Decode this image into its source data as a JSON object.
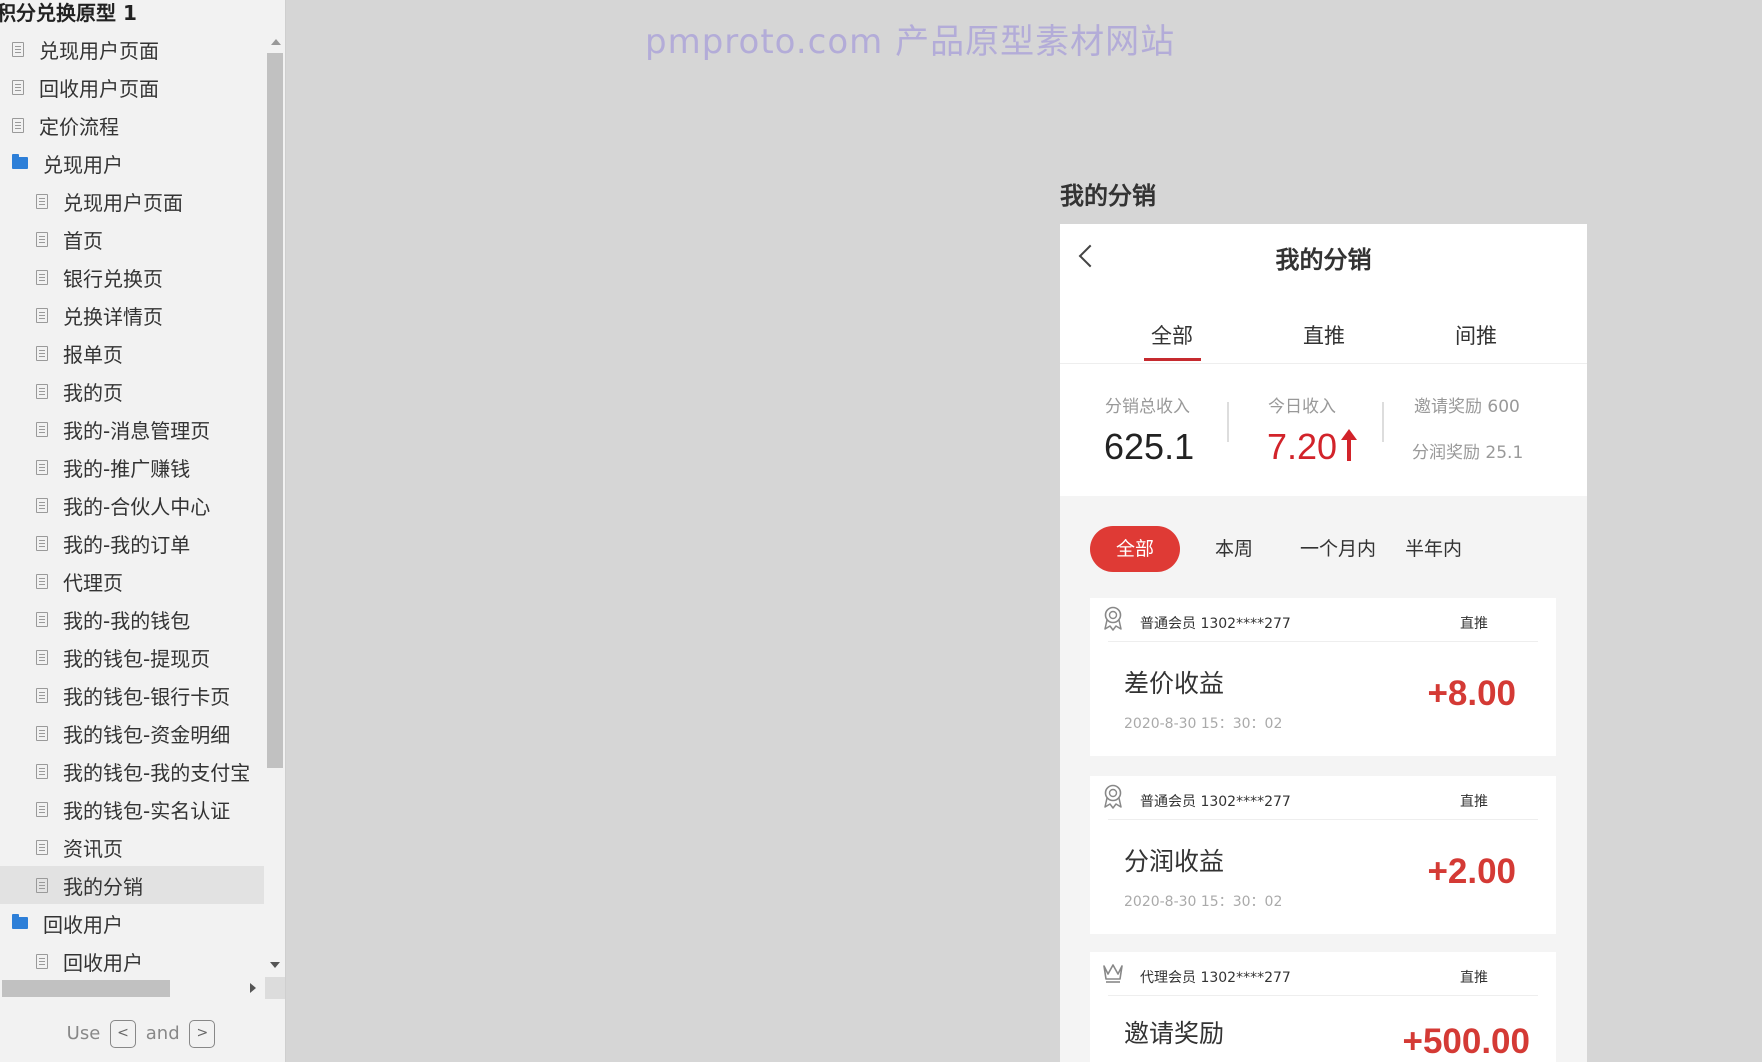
{
  "sidebar": {
    "title": "积分兑换原型 1",
    "items": [
      {
        "label": "兑现用户页面",
        "type": "page"
      },
      {
        "label": "回收用户页面",
        "type": "page"
      },
      {
        "label": "定价流程",
        "type": "page"
      },
      {
        "label": "兑现用户",
        "type": "folder"
      },
      {
        "label": "兑现用户页面",
        "type": "page"
      },
      {
        "label": "首页",
        "type": "page"
      },
      {
        "label": "银行兑换页",
        "type": "page"
      },
      {
        "label": "兑换详情页",
        "type": "page"
      },
      {
        "label": "报单页",
        "type": "page"
      },
      {
        "label": "我的页",
        "type": "page"
      },
      {
        "label": "我的-消息管理页",
        "type": "page"
      },
      {
        "label": "我的-推广赚钱",
        "type": "page"
      },
      {
        "label": "我的-合伙人中心",
        "type": "page"
      },
      {
        "label": "我的-我的订单",
        "type": "page"
      },
      {
        "label": "代理页",
        "type": "page"
      },
      {
        "label": "我的-我的钱包",
        "type": "page"
      },
      {
        "label": "我的钱包-提现页",
        "type": "page"
      },
      {
        "label": "我的钱包-银行卡页",
        "type": "page"
      },
      {
        "label": "我的钱包-资金明细",
        "type": "page"
      },
      {
        "label": "我的钱包-我的支付宝",
        "type": "page"
      },
      {
        "label": "我的钱包-实名认证",
        "type": "page"
      },
      {
        "label": "资讯页",
        "type": "page"
      },
      {
        "label": "我的分销",
        "type": "page",
        "selected": true
      },
      {
        "label": "回收用户",
        "type": "folder"
      },
      {
        "label": "回收用户",
        "type": "page"
      }
    ],
    "hint": {
      "use": "Use",
      "key_prev": "<",
      "and": "and",
      "key_next": ">"
    }
  },
  "watermark": "pmproto.com 产品原型素材网站",
  "frame_title": "我的分销",
  "phone": {
    "nav_title": "我的分销",
    "tabs": [
      "全部",
      "直推",
      "间推"
    ],
    "active_tab": 0,
    "stats": {
      "total_label": "分销总收入",
      "total_value": "625.1",
      "today_label": "今日收入",
      "today_value": "7.20",
      "invite_reward": "邀请奖励 600",
      "share_reward": "分润奖励 25.1"
    },
    "filters": [
      "全部",
      "本周",
      "一个月内",
      "半年内"
    ],
    "active_filter": 0,
    "records": [
      {
        "member": "普通会员 1302****277",
        "type": "直推",
        "title": "差价收益",
        "time": "2020-8-30 15：30：02",
        "amount": "+8.00",
        "icon": "medal-icon"
      },
      {
        "member": "普通会员 1302****277",
        "type": "直推",
        "title": "分润收益",
        "time": "2020-8-30 15：30：02",
        "amount": "+2.00",
        "icon": "medal-icon"
      },
      {
        "member": "代理会员 1302****277",
        "type": "直推",
        "title": "邀请奖励",
        "time": "",
        "amount": "+500.00",
        "icon": "crown-icon"
      }
    ]
  },
  "colors": {
    "accent": "#d2232a",
    "chip_active": "#df3a35",
    "folder": "#2d7fd8"
  }
}
